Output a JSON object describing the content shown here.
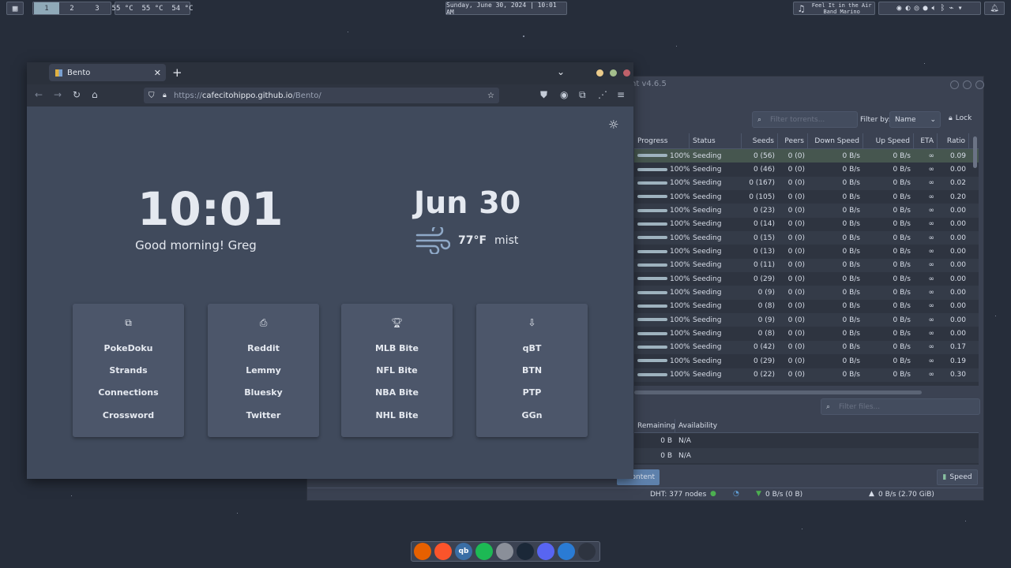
{
  "topbar": {
    "workspaces": [
      "1",
      "2",
      "3"
    ],
    "temps": "55 °C  55 °C  54 °C",
    "clock": "Sunday, June 30, 2024 | 10:01 AM",
    "song_title": "Feel It in the Air",
    "song_artist": "Band Marino"
  },
  "browser": {
    "tab_title": "Bento",
    "url_scheme": "https://",
    "url_host": "cafecitohippo.github.io",
    "url_path": "/Bento/"
  },
  "bento": {
    "time": "10:01",
    "greeting": "Good morning! Greg",
    "month": "Jun",
    "day": "30",
    "temperature": "77°F",
    "condition": "mist",
    "cards": [
      {
        "icon": "puzzle-icon",
        "links": [
          "PokeDoku",
          "Strands",
          "Connections",
          "Crossword"
        ]
      },
      {
        "icon": "inbox-icon",
        "links": [
          "Reddit",
          "Lemmy",
          "Bluesky",
          "Twitter"
        ]
      },
      {
        "icon": "trophy-icon",
        "links": [
          "MLB Bite",
          "NFL Bite",
          "NBA Bite",
          "NHL Bite"
        ]
      },
      {
        "icon": "download-icon",
        "links": [
          "qBT",
          "BTN",
          "PTP",
          "GGn"
        ]
      }
    ]
  },
  "qbittorrent": {
    "title_fragment": "nt v4.6.5",
    "filter_placeholder": "Filter torrents...",
    "filter_by_label": "Filter by:",
    "filter_by_value": "Name",
    "lock_label": "Lock",
    "columns": [
      "Progress",
      "Status",
      "Seeds",
      "Peers",
      "Down Speed",
      "Up Speed",
      "ETA",
      "Ratio"
    ],
    "rows": [
      [
        "100%",
        "Seeding",
        "0 (56)",
        "0 (0)",
        "0 B/s",
        "0 B/s",
        "∞",
        "0.09"
      ],
      [
        "100%",
        "Seeding",
        "0 (46)",
        "0 (0)",
        "0 B/s",
        "0 B/s",
        "∞",
        "0.00"
      ],
      [
        "100%",
        "Seeding",
        "0 (167)",
        "0 (0)",
        "0 B/s",
        "0 B/s",
        "∞",
        "0.02"
      ],
      [
        "100%",
        "Seeding",
        "0 (105)",
        "0 (0)",
        "0 B/s",
        "0 B/s",
        "∞",
        "0.20"
      ],
      [
        "100%",
        "Seeding",
        "0 (23)",
        "0 (0)",
        "0 B/s",
        "0 B/s",
        "∞",
        "0.00"
      ],
      [
        "100%",
        "Seeding",
        "0 (14)",
        "0 (0)",
        "0 B/s",
        "0 B/s",
        "∞",
        "0.00"
      ],
      [
        "100%",
        "Seeding",
        "0 (15)",
        "0 (0)",
        "0 B/s",
        "0 B/s",
        "∞",
        "0.00"
      ],
      [
        "100%",
        "Seeding",
        "0 (13)",
        "0 (0)",
        "0 B/s",
        "0 B/s",
        "∞",
        "0.00"
      ],
      [
        "100%",
        "Seeding",
        "0 (11)",
        "0 (0)",
        "0 B/s",
        "0 B/s",
        "∞",
        "0.00"
      ],
      [
        "100%",
        "Seeding",
        "0 (29)",
        "0 (0)",
        "0 B/s",
        "0 B/s",
        "∞",
        "0.00"
      ],
      [
        "100%",
        "Seeding",
        "0 (9)",
        "0 (0)",
        "0 B/s",
        "0 B/s",
        "∞",
        "0.00"
      ],
      [
        "100%",
        "Seeding",
        "0 (8)",
        "0 (0)",
        "0 B/s",
        "0 B/s",
        "∞",
        "0.00"
      ],
      [
        "100%",
        "Seeding",
        "0 (9)",
        "0 (0)",
        "0 B/s",
        "0 B/s",
        "∞",
        "0.00"
      ],
      [
        "100%",
        "Seeding",
        "0 (8)",
        "0 (0)",
        "0 B/s",
        "0 B/s",
        "∞",
        "0.00"
      ],
      [
        "100%",
        "Seeding",
        "0 (42)",
        "0 (0)",
        "0 B/s",
        "0 B/s",
        "∞",
        "0.17"
      ],
      [
        "100%",
        "Seeding",
        "0 (29)",
        "0 (0)",
        "0 B/s",
        "0 B/s",
        "∞",
        "0.19"
      ],
      [
        "100%",
        "Seeding",
        "0 (22)",
        "0 (0)",
        "0 B/s",
        "0 B/s",
        "∞",
        "0.30"
      ]
    ],
    "files_filter_placeholder": "Filter files...",
    "files_columns": [
      "Remaining",
      "Availability"
    ],
    "files_rows": [
      [
        "0 B",
        "N/A"
      ],
      [
        "0 B",
        "N/A"
      ]
    ],
    "content_tab": "ontent",
    "speed_tab": "Speed",
    "dht": "DHT: 377 nodes",
    "down_status": "0 B/s (0 B)",
    "up_status": "0 B/s (2.70 GiB)"
  },
  "dock": {
    "apps": [
      {
        "icon": "firefox-icon",
        "color": "#e66000"
      },
      {
        "icon": "brave-icon",
        "color": "#fb542b"
      },
      {
        "icon": "qbittorrent-icon",
        "color": "#3a6ea5",
        "text": "qb"
      },
      {
        "icon": "spotify-icon",
        "color": "#1db954"
      },
      {
        "icon": "emulator-icon",
        "color": "#8a8f99"
      },
      {
        "icon": "steam-icon",
        "color": "#1b2838"
      },
      {
        "icon": "discord-icon",
        "color": "#5865f2"
      },
      {
        "icon": "files-icon",
        "color": "#2a7bd4"
      },
      {
        "icon": "terminal-icon",
        "color": "#2e3440"
      }
    ]
  }
}
